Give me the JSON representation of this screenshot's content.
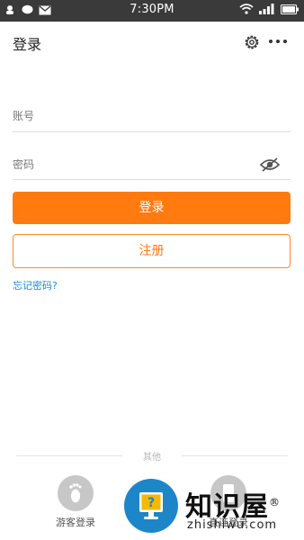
{
  "status_bar": {
    "time": "7:30PM"
  },
  "header": {
    "title": "登录"
  },
  "form": {
    "account_placeholder": "账号",
    "password_placeholder": "密码",
    "login_label": "登录",
    "register_label": "注册",
    "forgot_label": "忘记密码?"
  },
  "footer": {
    "divider_label": "其他",
    "guest_label": "游客登录",
    "quick_label": "直连登录"
  },
  "watermark": {
    "name": "知识屋",
    "registered": "®",
    "domain": "zhishiwu.com"
  },
  "colors": {
    "accent": "#ff7a0f",
    "link": "#1a8ad6",
    "statusbar": "#3a3a3a"
  }
}
